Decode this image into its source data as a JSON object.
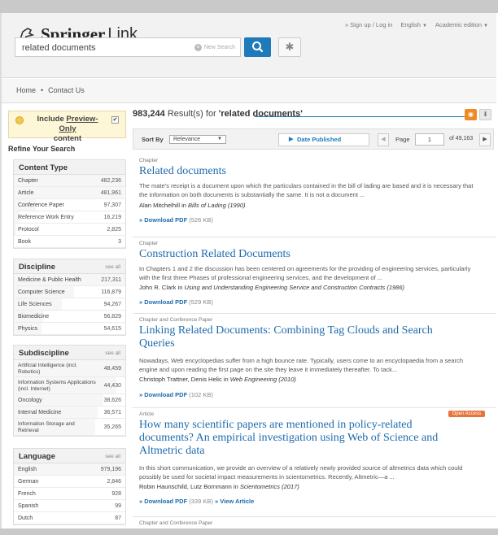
{
  "header": {
    "logo_springer": "Springer",
    "logo_link": "Link",
    "sign_up": "» Sign up / Log in",
    "language": "English",
    "edition": "Academic edition"
  },
  "search": {
    "query": "related documents",
    "new_search": "New Search"
  },
  "nav": {
    "home": "Home",
    "separator": "•",
    "contact": "Contact Us"
  },
  "sidebar": {
    "preview_include": "Include",
    "preview_link": "Preview-Only",
    "preview_content": "content",
    "refine_title": "Refine Your Search",
    "see_all": "see all",
    "content_type": {
      "title": "Content Type",
      "items": [
        {
          "label": "Chapter",
          "count": "482,236",
          "share": 1.0
        },
        {
          "label": "Article",
          "count": "481,961",
          "share": 0.99
        },
        {
          "label": "Conference Paper",
          "count": "97,307",
          "share": 0.2
        },
        {
          "label": "Reference Work Entry",
          "count": "16,219",
          "share": 0.05
        },
        {
          "label": "Protocol",
          "count": "2,825",
          "share": 0.02
        },
        {
          "label": "Book",
          "count": "3",
          "share": 0.0
        }
      ]
    },
    "discipline": {
      "title": "Discipline",
      "items": [
        {
          "label": "Medicine & Public Health",
          "count": "217,311",
          "share": 1.0
        },
        {
          "label": "Computer Science",
          "count": "116,879",
          "share": 0.54
        },
        {
          "label": "Life Sciences",
          "count": "94,267",
          "share": 0.43
        },
        {
          "label": "Biomedicine",
          "count": "56,829",
          "share": 0.26
        },
        {
          "label": "Physics",
          "count": "54,615",
          "share": 0.25
        }
      ]
    },
    "subdiscipline": {
      "title": "Subdiscipline",
      "items": [
        {
          "label": "Artificial Intelligence (incl. Robotics)",
          "count": "48,459",
          "share": 1.0,
          "tall": true
        },
        {
          "label": "Information Systems Applications (incl. Internet)",
          "count": "44,430",
          "share": 0.92,
          "tall": true
        },
        {
          "label": "Oncology",
          "count": "38,626",
          "share": 0.8
        },
        {
          "label": "Internal Medicine",
          "count": "36,571",
          "share": 0.75
        },
        {
          "label": "Information Storage and Retrieval",
          "count": "35,265",
          "share": 0.73,
          "tall": true
        }
      ]
    },
    "language": {
      "title": "Language",
      "items": [
        {
          "label": "English",
          "count": "979,196",
          "share": 1.0
        },
        {
          "label": "German",
          "count": "2,846",
          "share": 0.01
        },
        {
          "label": "French",
          "count": "928",
          "share": 0.0
        },
        {
          "label": "Spanish",
          "count": "99",
          "share": 0.0
        },
        {
          "label": "Dutch",
          "count": "87",
          "share": 0.0
        }
      ]
    }
  },
  "main": {
    "result_number": "983,244",
    "result_text": " Result(s) for ",
    "result_query": "'related documents'",
    "sort_by": "Sort By",
    "sort_value": "Relevance",
    "date_published": "Date Published",
    "page_label": "Page",
    "page_value": "1",
    "page_of": "of 49,163"
  },
  "results": [
    {
      "type": "Chapter",
      "title": "Related documents",
      "snippet": "The mate's receipt is a document upon which the particulars contained in the bill of lading are based and it is necessary that the information on both documents is substantially the same. It is not a document ...",
      "authors": "Alan Mitchelhill",
      "in": " in ",
      "source": "Bills of Lading (1990)",
      "download": "» Download PDF",
      "size": " (526 KB)"
    },
    {
      "type": "Chapter",
      "title": "Construction Related Documents",
      "snippet": "In Chapters 1 and 2 the discussion has been centered on agreements for the providing of engineering services, particularly with the first three Phases of professional engineering services, and the development of ...",
      "authors": "John R. Clark",
      "in": " in ",
      "source": "Using and Understanding Engineering Service and Construction Contracts (1986)",
      "download": "» Download PDF",
      "size": " (529 KB)"
    },
    {
      "type": "Chapter and Conference Paper",
      "title": "Linking Related Documents: Combining Tag Clouds and Search Queries",
      "snippet": "Nowadays, Web encyclopedias suffer from a high bounce rate. Typically, users come to an encyclopaedia from a search engine and upon reading the first page on the site they leave it immediately thereafter. To tack...",
      "authors": "Christoph Trattner, Denis Helic",
      "in": " in ",
      "source": "Web Engineering (2010)",
      "download": "» Download PDF",
      "size": " (102 KB)"
    },
    {
      "type": "Article",
      "badge": "Open Access",
      "title": "How many scientific papers are mentioned in policy-related documents? An empirical investigation using Web of Science and Altmetric data",
      "snippet": "In this short communication, we provide an overview of a relatively newly provided source of altmetrics data which could possibly be used for societal impact measurements in scientometrics. Recently, Altmetric—a ...",
      "authors": "Robin Haunschild, Lutz Bornmann",
      "in": " in ",
      "source": "Scientometrics (2017)",
      "download": "» Download PDF",
      "size": " (339 KB)",
      "view": " » View Article"
    },
    {
      "type": "Chapter and Conference Paper"
    }
  ]
}
